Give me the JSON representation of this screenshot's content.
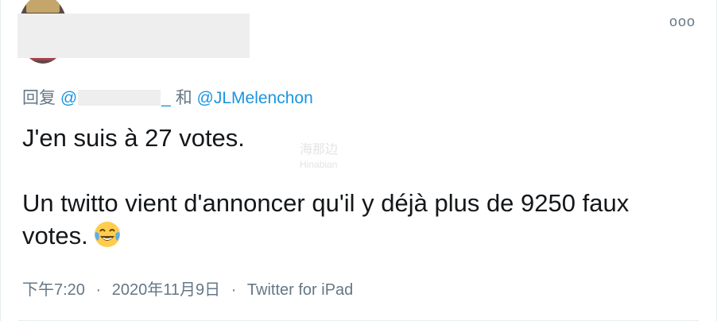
{
  "header": {
    "more_label": "ooo"
  },
  "reply": {
    "prefix": "回复",
    "at_sign": "@",
    "underscore": "_",
    "conjunction": "和",
    "mention": "@JLMelenchon"
  },
  "tweet": {
    "paragraph_1": "J'en suis à 27 votes.",
    "paragraph_2": "Un twitto vient d'annoncer qu'il y déjà plus de 9250 faux votes.",
    "emoji": "face-with-tears-of-joy"
  },
  "meta": {
    "time": "下午7:20",
    "separator": "·",
    "date": "2020年11月9日",
    "source": "Twitter for iPad"
  },
  "watermark": {
    "text": "海那边",
    "sub": "Hinabian"
  },
  "colors": {
    "link": "#1b95e0",
    "secondary_text": "#657786",
    "primary_text": "#14171a"
  }
}
